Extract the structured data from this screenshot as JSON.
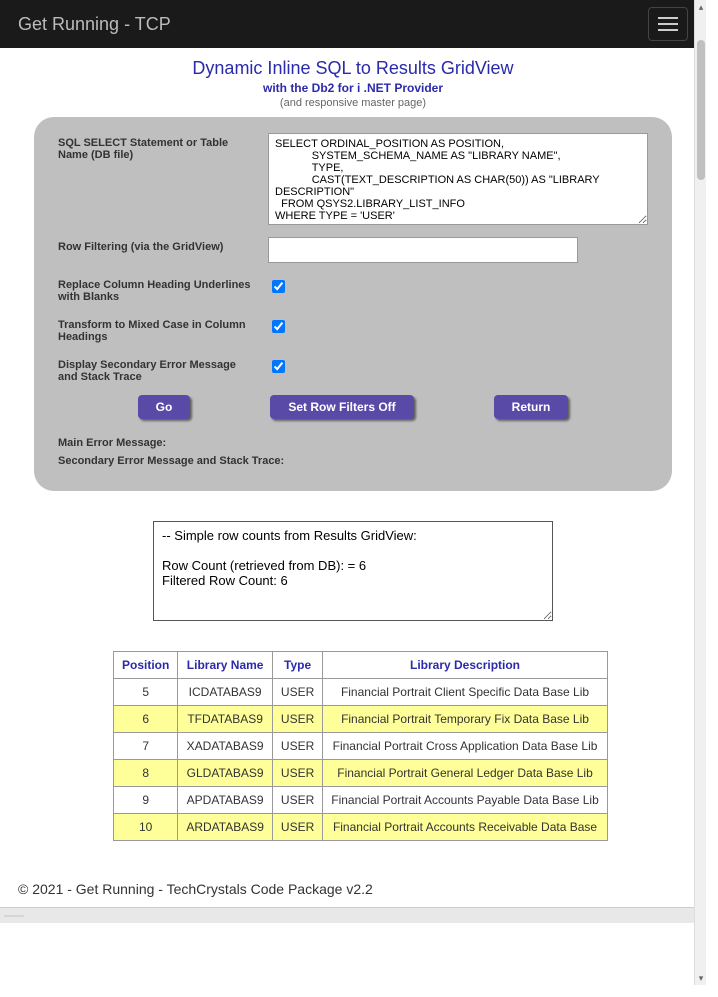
{
  "navbar": {
    "brand": "Get Running - TCP"
  },
  "headline": {
    "title": "Dynamic Inline SQL to Results GridView",
    "subtitle": "with the Db2 for i .NET Provider",
    "note": "(and responsive master page)"
  },
  "form": {
    "sql_label": "SQL SELECT Statement or Table Name (DB file)",
    "sql_value": "SELECT ORDINAL_POSITION AS POSITION,\n            SYSTEM_SCHEMA_NAME AS \"LIBRARY NAME\",\n            TYPE,\n            CAST(TEXT_DESCRIPTION AS CHAR(50)) AS \"LIBRARY DESCRIPTION\"\n  FROM QSYS2.LIBRARY_LIST_INFO\nWHERE TYPE = 'USER'",
    "filter_label": "Row Filtering (via the GridView)",
    "filter_value": "",
    "replace_label": "Replace Column Heading Underlines with Blanks",
    "replace_checked": true,
    "mixed_label": "Transform to Mixed Case in Column Headings",
    "mixed_checked": true,
    "stack_label": "Display Secondary Error Message and Stack Trace",
    "stack_checked": true,
    "main_err_label": "Main Error Message:",
    "secondary_err_label": "Secondary Error Message and Stack Trace:"
  },
  "buttons": {
    "go": "Go",
    "filters_off": "Set Row Filters Off",
    "return": "Return"
  },
  "log": "-- Simple row counts from Results GridView:\n\nRow Count (retrieved from DB): = 6\nFiltered Row Count: 6",
  "grid": {
    "headers": [
      "Position",
      "Library Name",
      "Type",
      "Library Description"
    ],
    "rows": [
      [
        "5",
        "ICDATABAS9",
        "USER",
        "Financial Portrait Client Specific Data Base Lib"
      ],
      [
        "6",
        "TFDATABAS9",
        "USER",
        "Financial Portrait Temporary Fix Data Base Lib"
      ],
      [
        "7",
        "XADATABAS9",
        "USER",
        "Financial Portrait Cross Application Data Base Lib"
      ],
      [
        "8",
        "GLDATABAS9",
        "USER",
        "Financial Portrait General Ledger Data Base Lib"
      ],
      [
        "9",
        "APDATABAS9",
        "USER",
        "Financial Portrait Accounts Payable Data Base Lib"
      ],
      [
        "10",
        "ARDATABAS9",
        "USER",
        "Financial Portrait Accounts Receivable Data Base"
      ]
    ]
  },
  "footer": "© 2021 - Get Running - TechCrystals Code Package v2.2",
  "statusbar": {
    "left": "",
    "right": ">"
  }
}
